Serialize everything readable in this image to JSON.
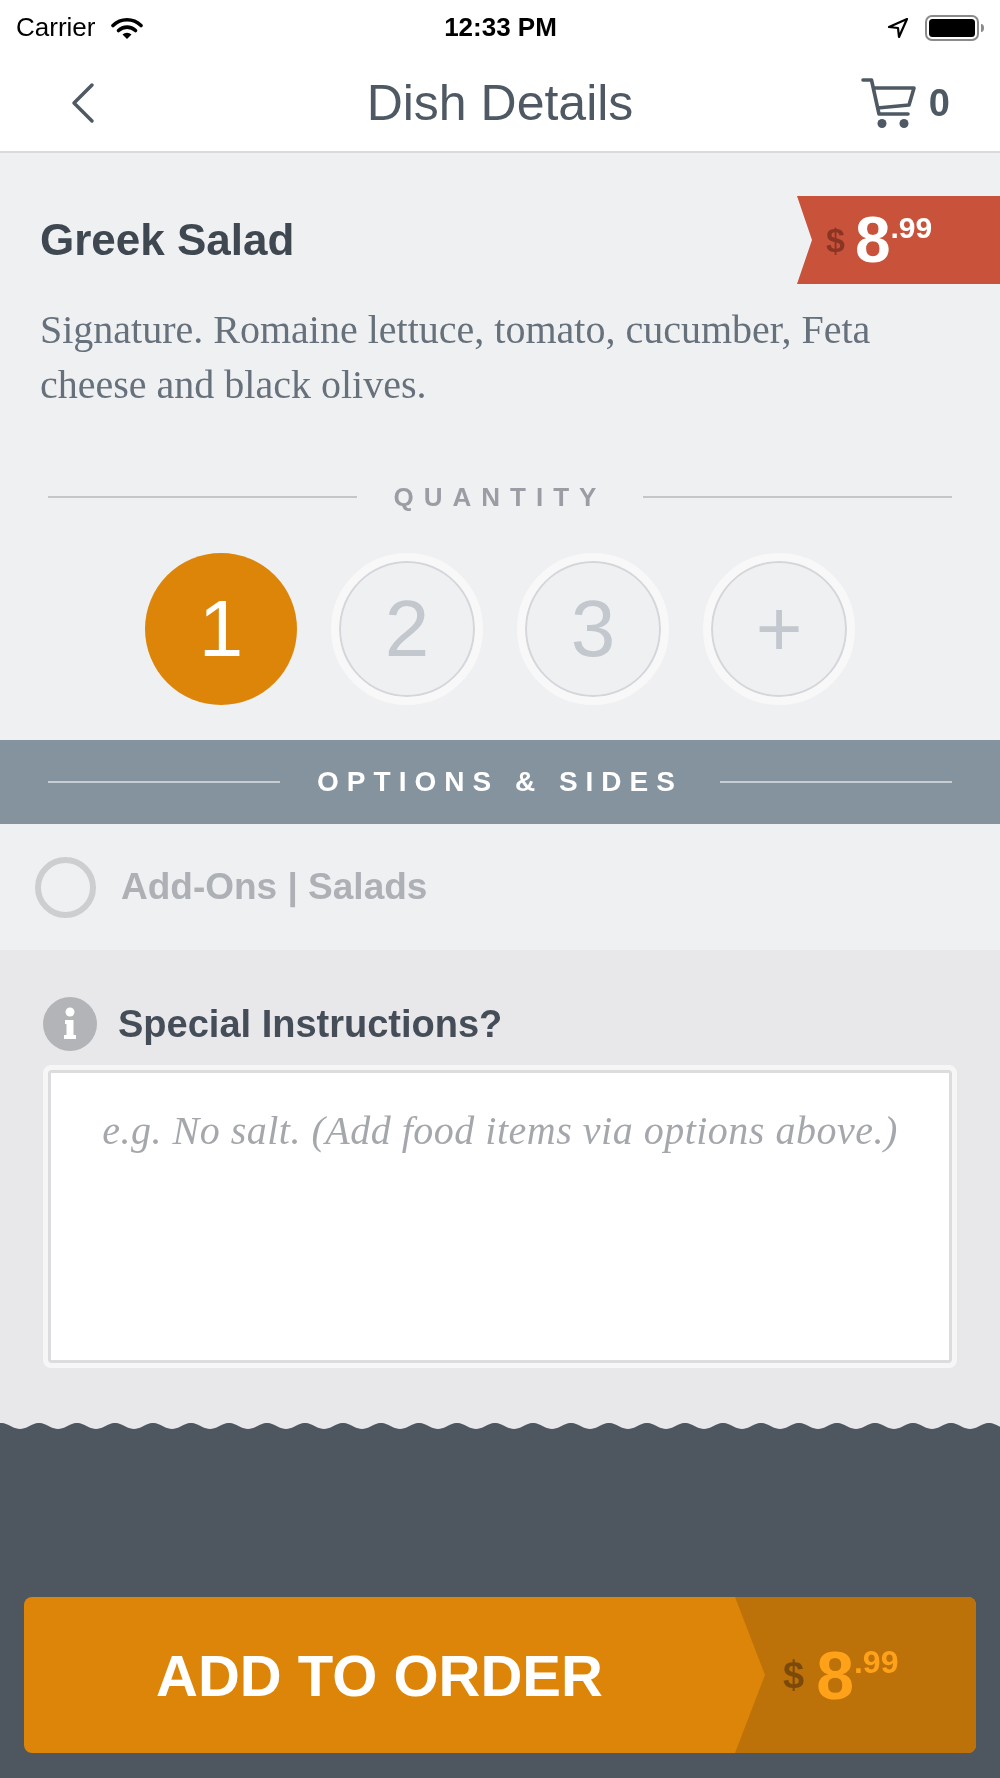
{
  "status_bar": {
    "carrier": "Carrier",
    "time": "12:33 PM"
  },
  "nav_bar": {
    "title": "Dish Details",
    "cart_count": "0"
  },
  "dish": {
    "name": "Greek Salad",
    "price": {
      "currency": "$",
      "amount": "8$^{.99}$"
    },
    "description": "Signature. Romaine lettuce, tomato, cucumber, Feta cheese and black olives."
  },
  "quantity": {
    "heading": "QUANTITY",
    "options": [
      {
        "label": "1",
        "selected": true
      },
      {
        "label": "2",
        "selected": false
      },
      {
        "label": "3",
        "selected": false
      },
      {
        "label": "+",
        "selected": false
      }
    ]
  },
  "options_sides": {
    "heading": "OPTIONS & SIDES",
    "items": [
      {
        "label": "Add-Ons | Salads",
        "checked": false
      }
    ]
  },
  "special_instructions": {
    "label": "Special Instructions?",
    "placeholder": "e.g. No salt. (Add food items via options above.)"
  },
  "add_to_order": {
    "label": "ADD TO ORDER",
    "price": {
      "currency": "$",
      "amount": "8$^{.99}$"
    }
  }
}
